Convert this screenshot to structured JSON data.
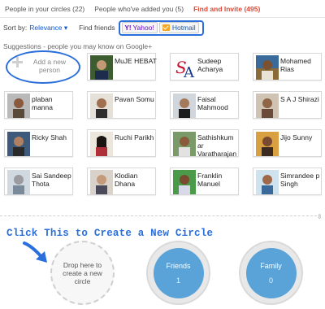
{
  "tabs": [
    {
      "label": "People in your circles (22)"
    },
    {
      "label": "People who've added you (5)"
    },
    {
      "label": "Find and Invite (495)"
    }
  ],
  "toolbar": {
    "sort_label": "Sort by:",
    "sort_value": "Relevance ▾",
    "find_label": "Find friends",
    "yahoo": "Yahoo!",
    "hotmail": "Hotmail"
  },
  "suggestions_label": "Suggestions - people you may know on Google+",
  "add_person": {
    "label": "Add a new person"
  },
  "people": [
    {
      "name": "MuJE HEBAT"
    },
    {
      "name": "Sudeep Acharya"
    },
    {
      "name": "Mohamed Rias"
    },
    {
      "name": "plaban manna"
    },
    {
      "name": "Pavan Somu"
    },
    {
      "name": "Faisal Mahmood"
    },
    {
      "name": "S A J Shirazi"
    },
    {
      "name": "Ricky Shah"
    },
    {
      "name": "Ruchi Parikh"
    },
    {
      "name": "Sathishkum ar Varatharajan"
    },
    {
      "name": "Jijo Sunny"
    },
    {
      "name": "Sai Sandeep Thota"
    },
    {
      "name": "Klodian Dhana"
    },
    {
      "name": "Franklin Manuel"
    },
    {
      "name": "Simrandee p Singh"
    }
  ],
  "callout": "Click This to Create a New Circle",
  "drop_zone": {
    "label": "Drop here to create a new circle"
  },
  "circles": [
    {
      "name": "Friends",
      "count": "1"
    },
    {
      "name": "Family",
      "count": "0"
    }
  ],
  "colors": {
    "accent": "#dd4b39",
    "annotation": "#2a6fdb",
    "circle": "#5aa3d9"
  }
}
